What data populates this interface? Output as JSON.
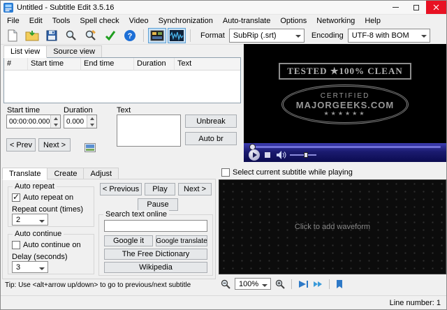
{
  "window": {
    "title": "Untitled - Subtitle Edit 3.5.16"
  },
  "menu": {
    "items": [
      "File",
      "Edit",
      "Tools",
      "Spell check",
      "Video",
      "Synchronization",
      "Auto-translate",
      "Options",
      "Networking",
      "Help"
    ]
  },
  "toolbar": {
    "format_label": "Format",
    "format_value": "SubRip (.srt)",
    "encoding_label": "Encoding",
    "encoding_value": "UTF-8 with BOM"
  },
  "icons": {
    "help_glyph": "?",
    "toolbar": [
      "new-file",
      "open-file",
      "save",
      "find",
      "replace",
      "spell-check",
      "help",
      "toggle-video-view",
      "toggle-waveform-view"
    ]
  },
  "subtitle_list": {
    "tabs": [
      "List view",
      "Source view"
    ],
    "columns": [
      "#",
      "Start time",
      "End time",
      "Duration",
      "Text"
    ],
    "rows": []
  },
  "edit_panel": {
    "start_time_label": "Start time",
    "start_time_value": "00:00:00.000",
    "duration_label": "Duration",
    "duration_value": "0.000",
    "text_label": "Text",
    "unbreak_button": "Unbreak",
    "auto_br_button": "Auto br",
    "prev_button": "< Prev",
    "next_button": "Next >"
  },
  "video_player": {
    "watermark": {
      "tested_line": "TESTED ★100% CLEAN",
      "certified": "CERTIFIED",
      "site": "MAJORGEEKS.COM",
      "stars": "★★★★★★"
    }
  },
  "translate_panel": {
    "tabs": [
      "Translate",
      "Create",
      "Adjust"
    ],
    "auto_repeat_group": "Auto repeat",
    "auto_repeat_checkbox": "Auto repeat on",
    "auto_repeat_checked": true,
    "repeat_count_label": "Repeat count (times)",
    "repeat_count_value": "2",
    "auto_continue_group": "Auto continue",
    "auto_continue_checkbox": "Auto continue on",
    "auto_continue_checked": false,
    "delay_label": "Delay (seconds)",
    "delay_value": "3",
    "previous_button": "< Previous",
    "play_button": "Play",
    "next_button": "Next >",
    "pause_button": "Pause",
    "search_group": "Search text online",
    "search_value": "",
    "google_it_button": "Google it",
    "google_translate_button": "Google translate",
    "free_dictionary_button": "The Free Dictionary",
    "wikipedia_button": "Wikipedia",
    "tip": "Tip: Use <alt+arrow up/down> to go to previous/next subtitle"
  },
  "waveform_panel": {
    "select_checkbox": "Select current subtitle while playing",
    "placeholder": "Click to add waveform",
    "zoom_value": "100%"
  },
  "status_bar": {
    "line_number": "Line number: 1"
  }
}
